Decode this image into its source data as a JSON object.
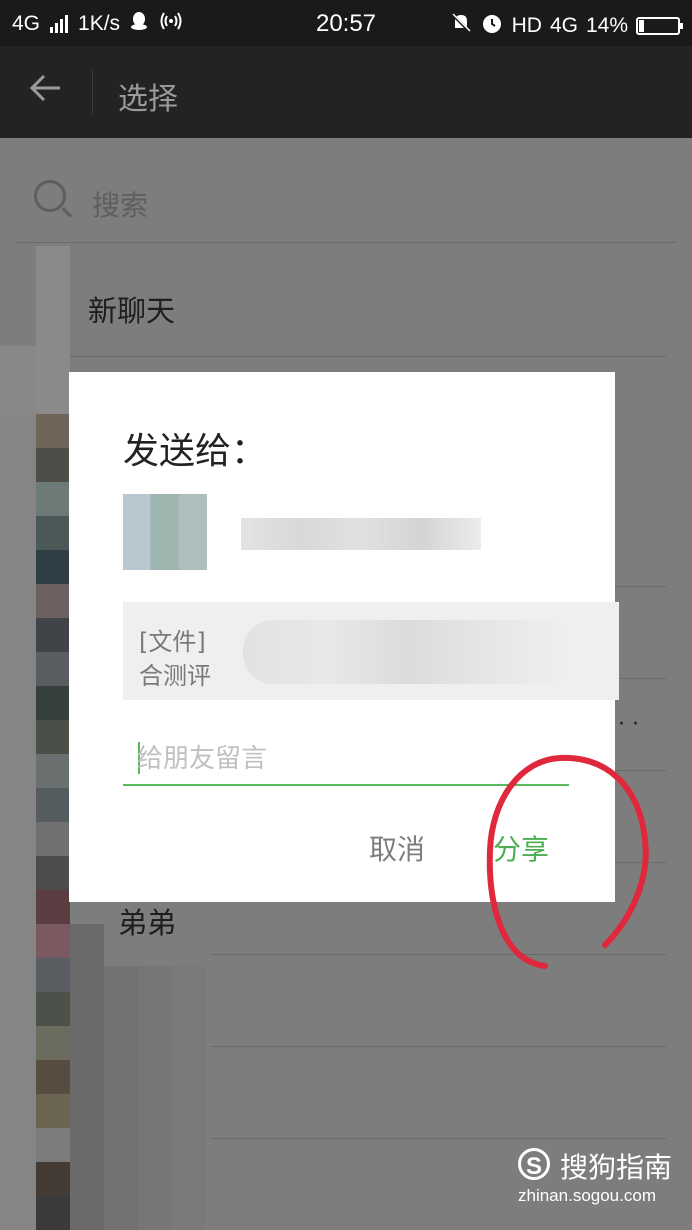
{
  "status_bar": {
    "network": "4G",
    "speed": "1K/s",
    "time": "20:57",
    "hd": "HD",
    "net2": "4G",
    "battery_text": "14%",
    "battery_level": 0.14
  },
  "app_bar": {
    "title": "选择"
  },
  "search": {
    "placeholder": "搜索"
  },
  "list": {
    "new_chat": "新聊天",
    "contact_name": "弟弟"
  },
  "dialog": {
    "title": "发送给：",
    "preview_line1": "[文件]",
    "preview_line2": "合测评",
    "message_placeholder": "给朋友留言",
    "cancel_label": "取消",
    "share_label": "分享"
  },
  "watermark": {
    "brand": "搜狗指南",
    "url": "zhinan.sogou.com"
  },
  "colors": {
    "accent": "#4caf50",
    "annotation": "#e0283c",
    "overlay": "#7d7d7d"
  }
}
